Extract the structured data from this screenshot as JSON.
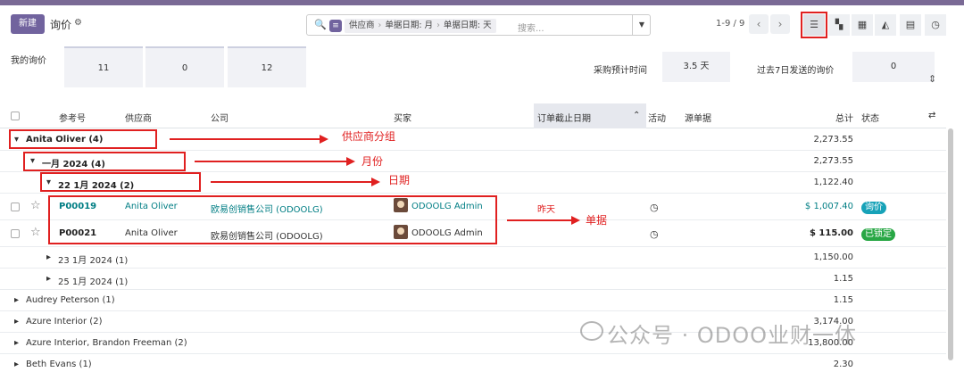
{
  "header": {
    "new_label": "新建",
    "title": "询价",
    "search": {
      "facet": "供应商 > 单据日期: 月 > 单据日期: 天",
      "facet_parts": [
        "供应商",
        "单据日期: 月",
        "单据日期: 天"
      ],
      "placeholder": "搜索..."
    },
    "pager": "1-9 / 9"
  },
  "stats": {
    "label": "我的询价",
    "box1": "11",
    "box2": "0",
    "box3": "12",
    "lead_time_label": "采购预计时间",
    "lead_time": "3.5 天",
    "sent_label": "过去7日发送的询价",
    "sent_value": "0"
  },
  "columns": {
    "ref": "参考号",
    "vendor": "供应商",
    "company": "公司",
    "buyer": "买家",
    "deadline": "订单截止日期",
    "activity": "活动",
    "source": "源单据",
    "total": "总计",
    "status": "状态"
  },
  "groups": [
    {
      "label": "Anita Oliver (4)",
      "total": "2,273.55"
    },
    {
      "label": "一月 2024 (4)",
      "total": "2,273.55"
    },
    {
      "label": "22 1月 2024 (2)",
      "total": "1,122.40"
    },
    {
      "label": "23 1月 2024 (1)",
      "total": "1,150.00"
    },
    {
      "label": "25 1月 2024 (1)",
      "total": "1.15"
    },
    {
      "label": "Audrey Peterson (1)",
      "total": "1.15"
    },
    {
      "label": "Azure Interior (2)",
      "total": "3,174.00"
    },
    {
      "label": "Azure Interior, Brandon Freeman (2)",
      "total": "13,800.00"
    },
    {
      "label": "Beth Evans (1)",
      "total": "2.30"
    }
  ],
  "records": [
    {
      "ref": "P00019",
      "vendor": "Anita Oliver",
      "company": "欧易创销售公司 (ODOOLG)",
      "buyer": "ODOOLG Admin",
      "deadline": "昨天",
      "total": "$ 1,007.40",
      "status": "询价",
      "status_color": "#17a2b8"
    },
    {
      "ref": "P00021",
      "vendor": "Anita Oliver",
      "company": "欧易创销售公司 (ODOOLG)",
      "buyer": "ODOOLG Admin",
      "deadline": "",
      "total": "$ 115.00",
      "status": "已锁定",
      "status_color": "#28a745"
    }
  ],
  "annotations": {
    "vendor_group": "供应商分组",
    "month": "月份",
    "day": "日期",
    "record": "单据"
  },
  "watermark": "公众号 · ODOO业财一体",
  "colors": {
    "brand": "#71639e",
    "accent": "#017e84",
    "annotation": "#e02020"
  }
}
